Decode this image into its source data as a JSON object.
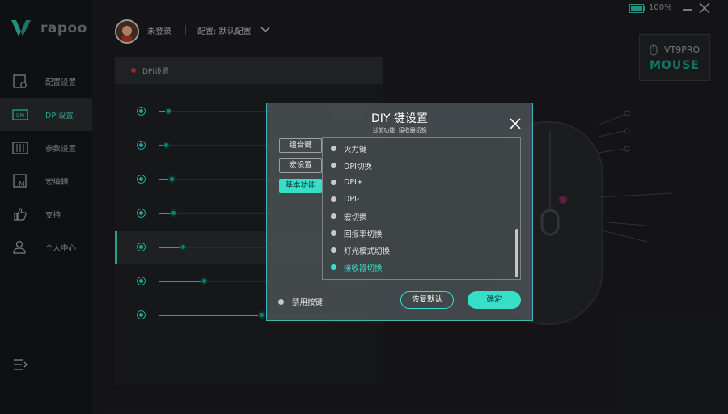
{
  "app": {
    "brand": "rapoo"
  },
  "sidebar": {
    "items": [
      {
        "label": "配置设置",
        "icon": "config-icon",
        "active": false
      },
      {
        "label": "DPI设置",
        "icon": "dpi-icon",
        "active": true
      },
      {
        "label": "参数设置",
        "icon": "sliders-icon",
        "active": false
      },
      {
        "label": "宏编辑",
        "icon": "macro-icon",
        "active": false
      },
      {
        "label": "支持",
        "icon": "thumbs-up-icon",
        "active": false
      },
      {
        "label": "个人中心",
        "icon": "user-icon",
        "active": false
      }
    ]
  },
  "topbar": {
    "user": "未登录",
    "profile": "配置: 默认配置",
    "battery": "100%"
  },
  "panel": {
    "title": "DPI设置",
    "rows": [
      {
        "level": 0.05,
        "active": false
      },
      {
        "level": 0.04,
        "active": false
      },
      {
        "level": 0.07,
        "active": false
      },
      {
        "level": 0.08,
        "active": false
      },
      {
        "level": 0.14,
        "active": true
      },
      {
        "level": 0.26,
        "active": false
      },
      {
        "level": 0.6,
        "active": false
      }
    ]
  },
  "model": {
    "name": "VT9PRO",
    "sub": "MOUSE"
  },
  "dialog": {
    "title": "DIY 键设置",
    "subtitle": "当前功能: 接收器切换",
    "tabs": [
      "组合键",
      "宏设置",
      "基本功能"
    ],
    "active_tab": 2,
    "items": [
      "火力键",
      "DPI切换",
      "DPI+",
      "DPI-",
      "宏切换",
      "回报率切换",
      "灯光模式切换",
      "接收器切换"
    ],
    "selected_index": 7,
    "disable_label": "禁用按键",
    "reset_label": "恢复默认",
    "ok_label": "确定"
  },
  "colors": {
    "accent": "#36e0c8"
  }
}
